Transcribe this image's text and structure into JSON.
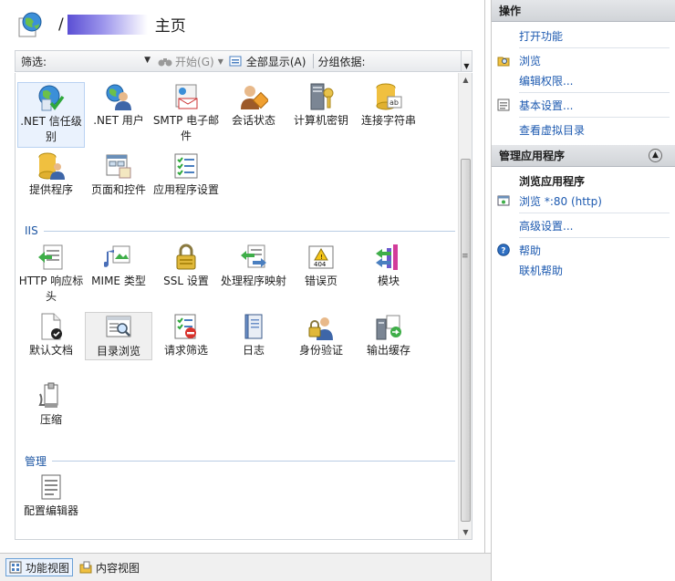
{
  "header": {
    "title": "主页",
    "slash": "/"
  },
  "toolbar": {
    "filter_label": "筛选:",
    "filter_value": "",
    "start_label": "开始(G)",
    "show_all_label": "全部显示(A)",
    "group_label": "分组依据:"
  },
  "sections": {
    "iis": "IIS",
    "management": "管理"
  },
  "features": {
    "net_trust": ".NET 信任级别",
    "net_users": ".NET 用户",
    "smtp": "SMTP 电子邮件",
    "session": "会话状态",
    "machine_key": "计算机密钥",
    "conn_strings": "连接字符串",
    "providers": "提供程序",
    "pages_controls": "页面和控件",
    "app_settings": "应用程序设置",
    "http_headers": "HTTP 响应标头",
    "mime": "MIME 类型",
    "ssl": "SSL 设置",
    "handlers": "处理程序映射",
    "error_pages": "错误页",
    "modules": "模块",
    "default_doc": "默认文档",
    "dir_browse": "目录浏览",
    "req_filter": "请求筛选",
    "logging": "日志",
    "auth": "身份验证",
    "output_cache": "输出缓存",
    "compression": "压缩",
    "config_editor": "配置编辑器"
  },
  "bottom": {
    "feature_view": "功能视图",
    "content_view": "内容视图"
  },
  "actions": {
    "title": "操作",
    "open_feature": "打开功能",
    "browse": "浏览",
    "edit_perms": "编辑权限...",
    "basic_settings": "基本设置...",
    "view_vdirs": "查看虚拟目录",
    "manage_title": "管理应用程序",
    "browse_app": "浏览应用程序",
    "browse_80": "浏览 *:80 (http)",
    "advanced": "高级设置...",
    "help": "帮助",
    "online_help": "联机帮助"
  }
}
